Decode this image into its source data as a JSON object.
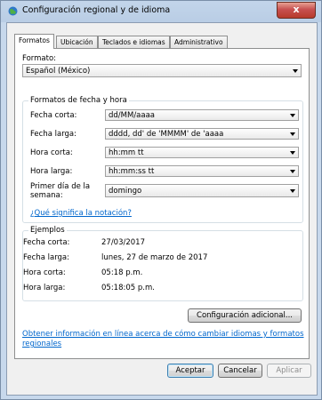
{
  "window": {
    "title": "Configuración regional y de idioma",
    "close_glyph": "x"
  },
  "tabs": [
    {
      "label": "Formatos",
      "active": true
    },
    {
      "label": "Ubicación",
      "active": false
    },
    {
      "label": "Teclados e idiomas",
      "active": false
    },
    {
      "label": "Administrativo",
      "active": false
    }
  ],
  "format": {
    "label": "Formato:",
    "value": "Español (México)"
  },
  "datetime": {
    "group_title": "Formatos de fecha y hora",
    "rows": [
      {
        "label": "Fecha corta:",
        "value": "dd/MM/aaaa"
      },
      {
        "label": "Fecha larga:",
        "value": "dddd, dd' de 'MMMM' de 'aaaa"
      },
      {
        "label": "Hora corta:",
        "value": "hh:mm tt"
      },
      {
        "label": "Hora larga:",
        "value": "hh:mm:ss tt"
      }
    ],
    "first_day": {
      "label_line1": "Primer día de la",
      "label_line2": "semana:",
      "value": "domingo"
    },
    "notation_link": "¿Qué significa la notación?"
  },
  "examples": {
    "group_title": "Ejemplos",
    "rows": [
      {
        "label": "Fecha corta:",
        "value": "27/03/2017"
      },
      {
        "label": "Fecha larga:",
        "value": "lunes, 27 de marzo de 2017"
      },
      {
        "label": "Hora corta:",
        "value": "05:18 p.m."
      },
      {
        "label": "Hora larga:",
        "value": "05:18:05 p.m."
      }
    ]
  },
  "additional_button": "Configuración adicional...",
  "online_link": {
    "line1": "Obtener información en línea acerca de cómo cambiar idiomas y formatos",
    "line2": "regionales"
  },
  "footer": {
    "accept": "Aceptar",
    "cancel": "Cancelar",
    "apply": "Aplicar"
  },
  "colors": {
    "link": "#0066cc",
    "titlebar": "#b9cde5",
    "close": "#c75050"
  }
}
